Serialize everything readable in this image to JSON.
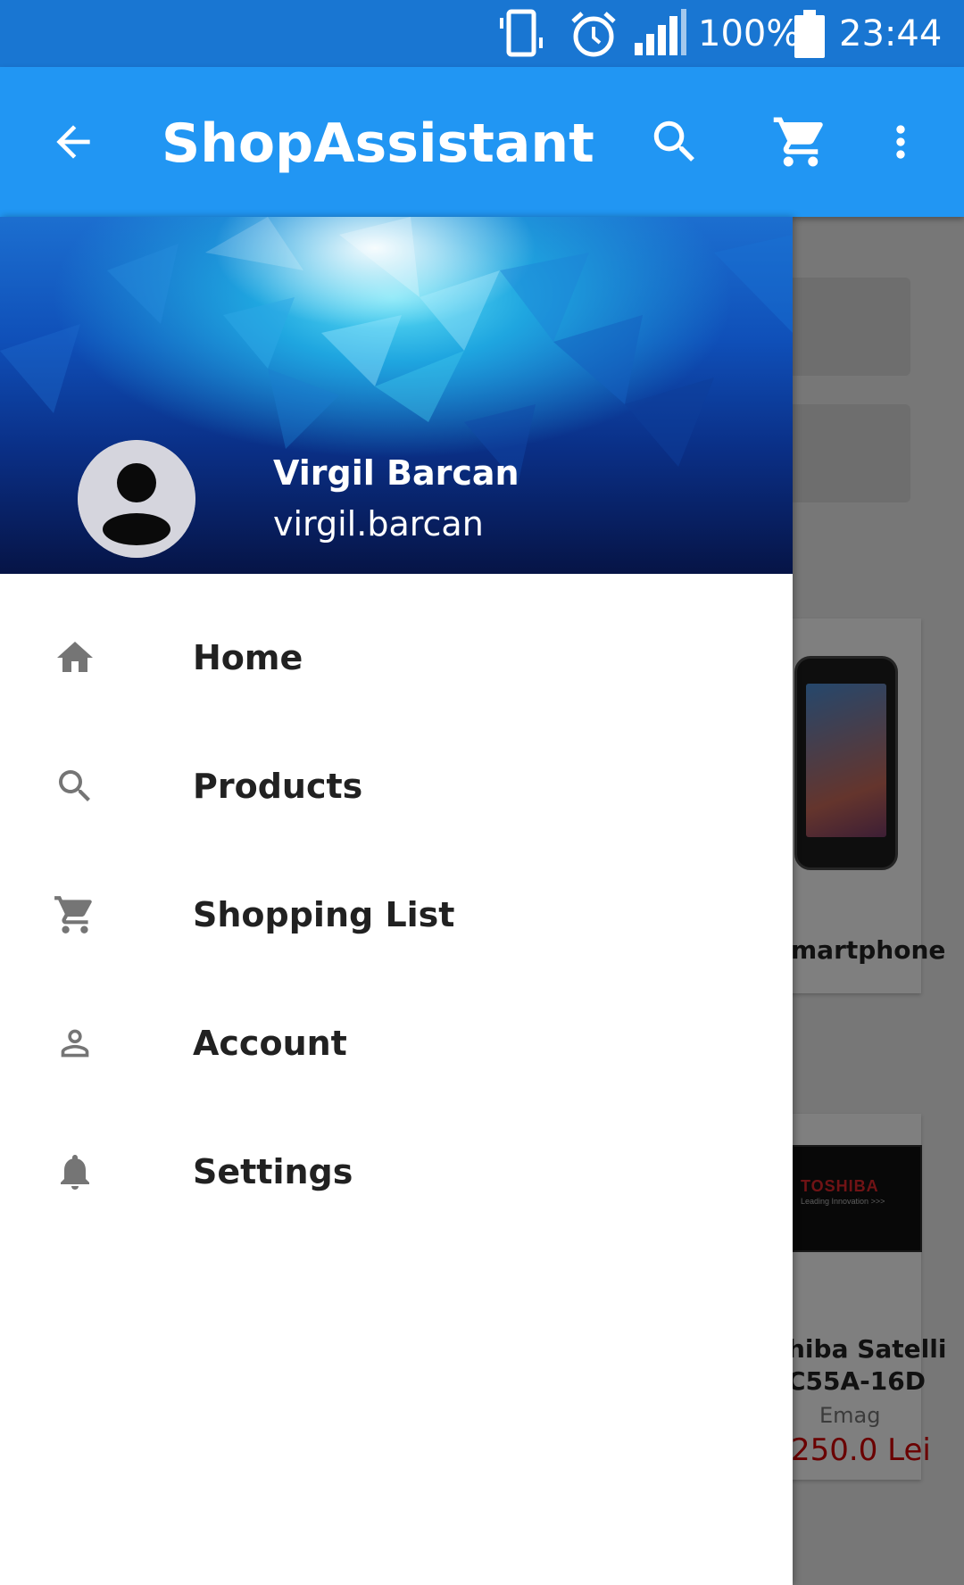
{
  "status_bar": {
    "battery_percent": "100%",
    "time": "23:44",
    "icons": [
      "vibrate-icon",
      "alarm-icon",
      "signal-icon",
      "battery-icon"
    ]
  },
  "app_bar": {
    "title": "ShopAssistant",
    "color": "#2196F3",
    "icons": [
      "back-arrow-icon",
      "search-icon",
      "cart-icon",
      "more-vert-icon"
    ]
  },
  "drawer": {
    "user": {
      "name": "Virgil Barcan",
      "email": "virgil.barcan"
    },
    "menu": [
      {
        "label": "Home",
        "icon": "home-icon"
      },
      {
        "label": "Products",
        "icon": "search-icon"
      },
      {
        "label": "Shopping List",
        "icon": "cart-icon"
      },
      {
        "label": "Account",
        "icon": "person-icon"
      },
      {
        "label": "Settings",
        "icon": "bell-icon"
      }
    ]
  },
  "background": {
    "card1_title": "martphone",
    "card2_title_line1": "hiba Satelli",
    "card2_title_line2": "C55A-16D",
    "card2_store": "Emag",
    "card2_price": "250.0 Lei",
    "laptop_brand": "TOSHIBA",
    "laptop_tagline": "Leading Innovation >>>"
  }
}
